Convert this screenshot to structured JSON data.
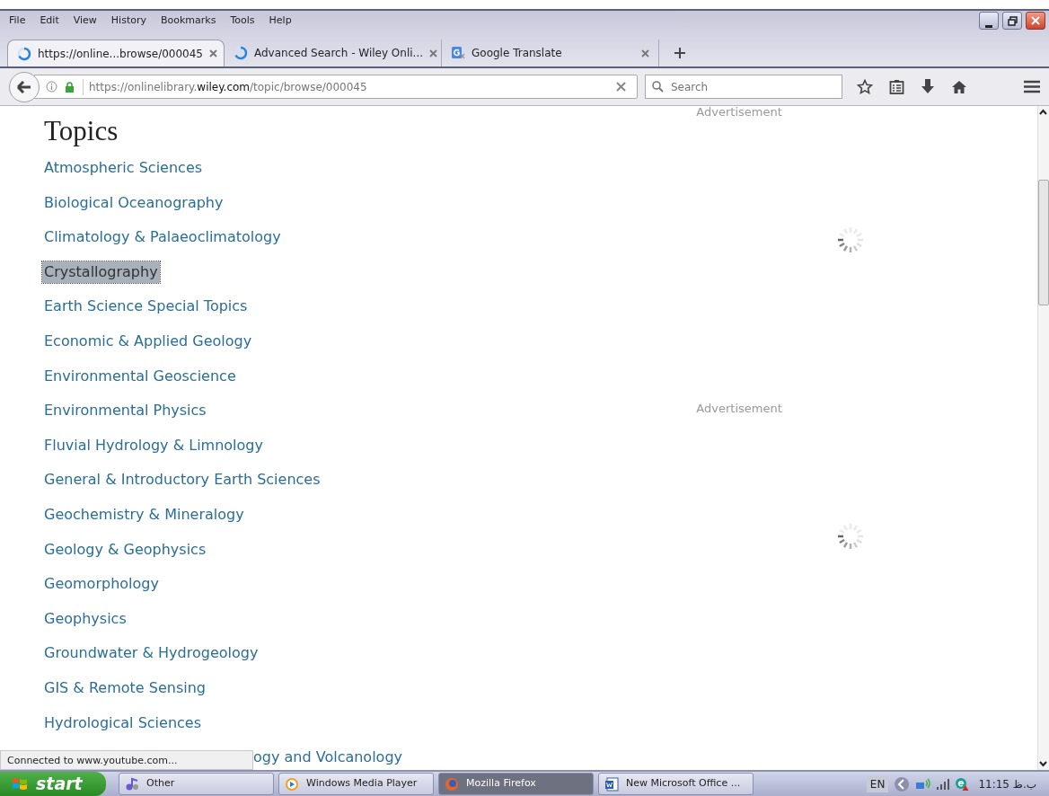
{
  "menu": [
    "File",
    "Edit",
    "View",
    "History",
    "Bookmarks",
    "Tools",
    "Help"
  ],
  "tabs": [
    {
      "label": "https://online...browse/000045",
      "kind": "loading",
      "selected": true
    },
    {
      "label": "Advanced Search - Wiley Onli...",
      "kind": "loading",
      "selected": false
    },
    {
      "label": "Google Translate",
      "kind": "translate",
      "selected": false
    }
  ],
  "address": {
    "prefix": "https://onlinelibrary.",
    "domain": "wiley.com",
    "path": "/topic/browse/000045"
  },
  "search": {
    "placeholder": "Search"
  },
  "page": {
    "title": "Topics",
    "topics": [
      {
        "label": "Atmospheric Sciences",
        "highlighted": false
      },
      {
        "label": "Biological Oceanography",
        "highlighted": false
      },
      {
        "label": "Climatology & Palaeoclimatology",
        "highlighted": false
      },
      {
        "label": "Crystallography",
        "highlighted": true
      },
      {
        "label": "Earth Science Special Topics",
        "highlighted": false
      },
      {
        "label": "Economic & Applied Geology",
        "highlighted": false
      },
      {
        "label": "Environmental Geoscience",
        "highlighted": false
      },
      {
        "label": "Environmental Physics",
        "highlighted": false
      },
      {
        "label": "Fluvial Hydrology & Limnology",
        "highlighted": false
      },
      {
        "label": "General & Introductory Earth Sciences",
        "highlighted": false
      },
      {
        "label": "Geochemistry & Mineralogy",
        "highlighted": false
      },
      {
        "label": "Geology & Geophysics",
        "highlighted": false
      },
      {
        "label": "Geomorphology",
        "highlighted": false
      },
      {
        "label": "Geophysics",
        "highlighted": false
      },
      {
        "label": "Groundwater & Hydrogeology",
        "highlighted": false
      },
      {
        "label": "GIS & Remote Sensing",
        "highlighted": false
      },
      {
        "label": "Hydrological Sciences",
        "highlighted": false
      },
      {
        "label": "ogy and Volcanology",
        "highlighted": false
      }
    ],
    "ads": [
      "Advertisement",
      "Advertisement"
    ]
  },
  "status_text": "Connected to www.youtube.com...",
  "taskbar": {
    "start": "start",
    "tasks": [
      {
        "label": "Other",
        "kind": "music",
        "selected": false
      },
      {
        "label": "Windows Media Player",
        "kind": "media",
        "selected": false
      },
      {
        "label": "Mozilla Firefox",
        "kind": "browser",
        "selected": true
      },
      {
        "label": "New Microsoft Office ...",
        "kind": "document",
        "selected": false
      }
    ],
    "language": "EN",
    "clock": "11:15 ب.ظ"
  }
}
